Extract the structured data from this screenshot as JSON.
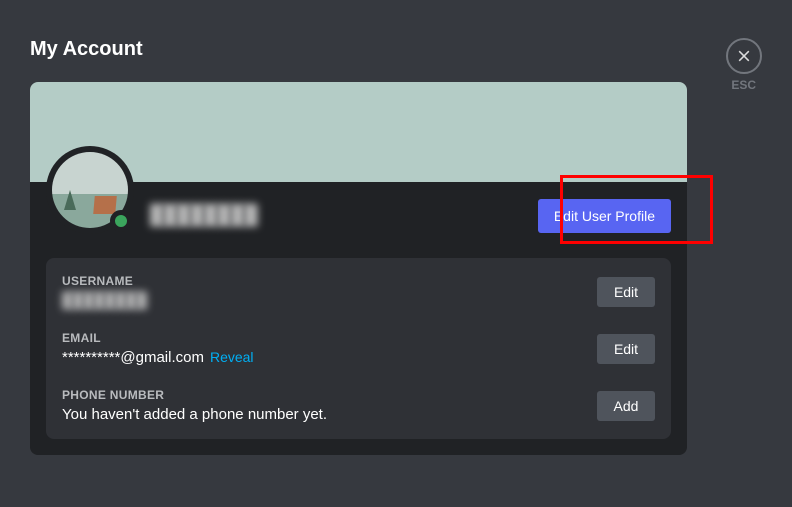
{
  "header": {
    "title": "My Account",
    "esc_label": "ESC"
  },
  "profile": {
    "display_name": "████████",
    "edit_profile_label": "Edit User Profile"
  },
  "fields": {
    "username": {
      "label": "Username",
      "value": "████████",
      "button": "Edit"
    },
    "email": {
      "label": "Email",
      "value": "**********@gmail.com",
      "reveal": "Reveal",
      "button": "Edit"
    },
    "phone": {
      "label": "Phone Number",
      "value": "You haven't added a phone number yet.",
      "button": "Add"
    }
  }
}
